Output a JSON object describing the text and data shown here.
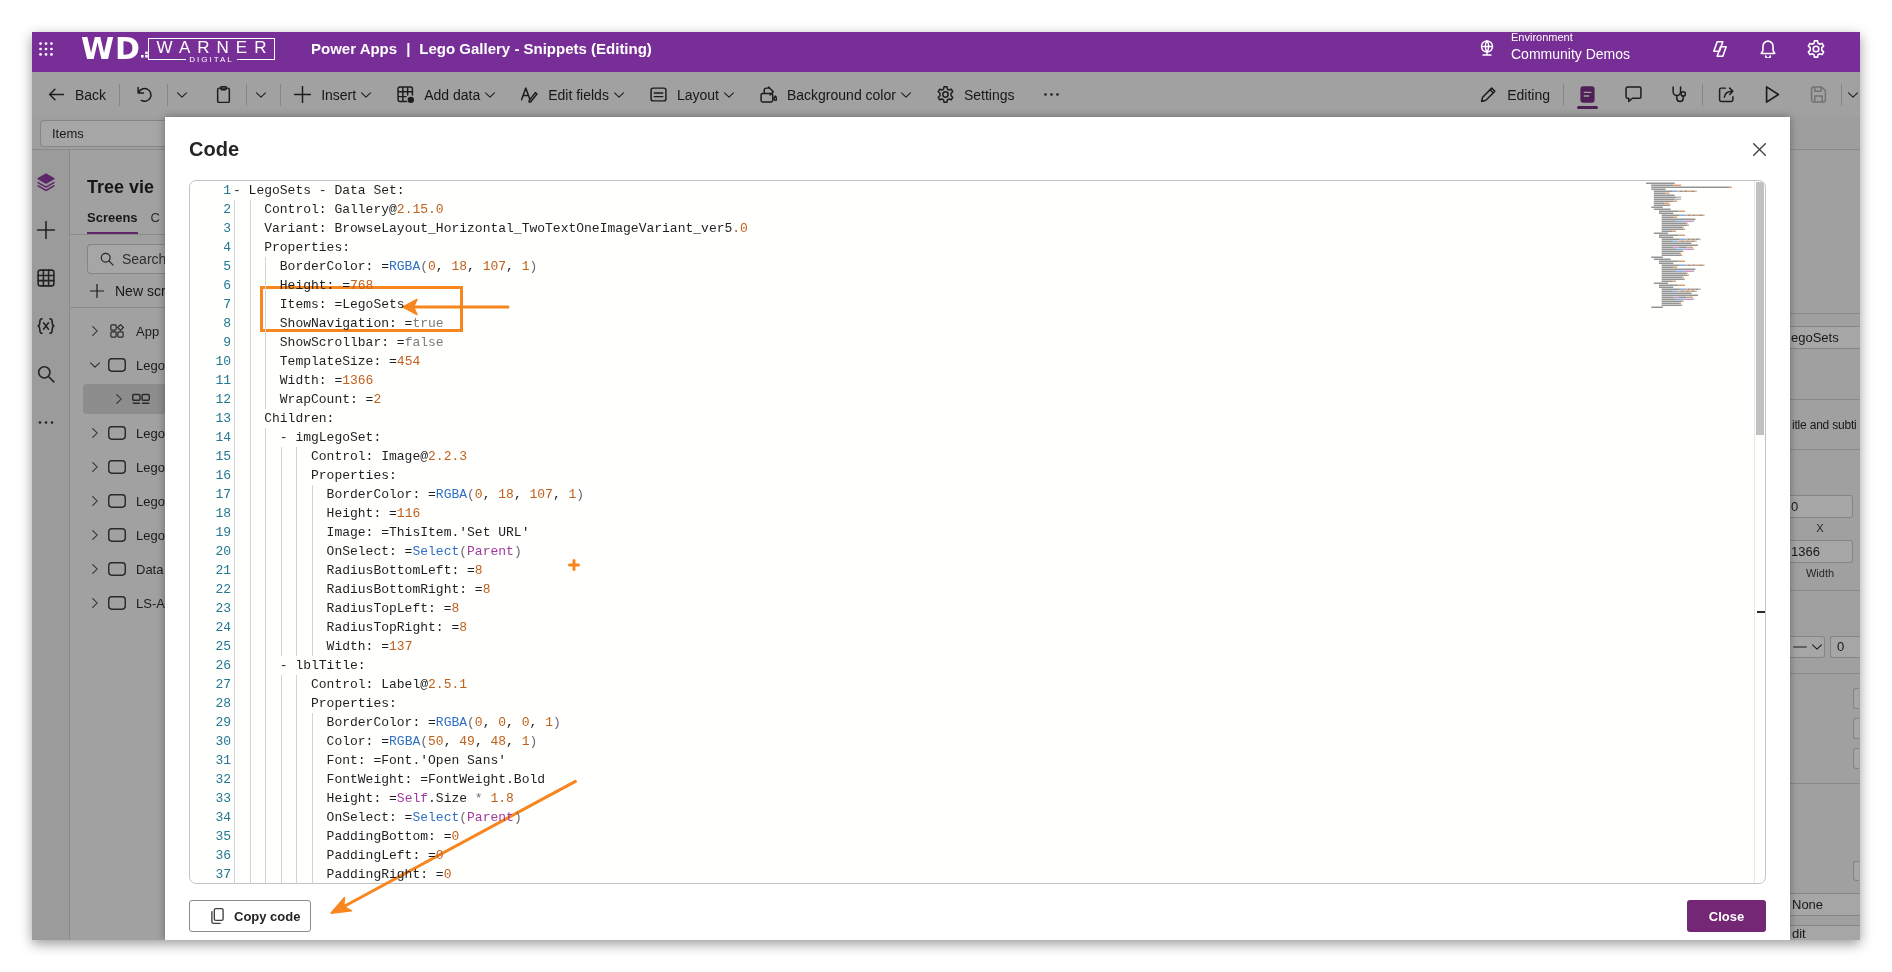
{
  "header": {
    "logo": {
      "mark": "WD",
      "wordmark": "WARNER",
      "tagline": "DIGITAL"
    },
    "app_name": "Power Apps",
    "separator": "|",
    "document_title": "Lego Gallery - Snippets (Editing)",
    "environment": {
      "label": "Environment",
      "name": "Community Demos"
    }
  },
  "toolbar": {
    "left": [
      {
        "label": "Back",
        "dropdown": false,
        "divider_after": true
      },
      {
        "dropdown": true,
        "divider_after": false
      },
      {
        "dropdown": true,
        "divider_after": true
      },
      {
        "label": "Insert",
        "dropdown": true,
        "divider_after": false
      },
      {
        "label": "Add data",
        "dropdown": true,
        "divider_after": false
      },
      {
        "label": "Edit fields",
        "dropdown": true,
        "divider_after": false
      },
      {
        "label": "Layout",
        "dropdown": true,
        "divider_after": false
      },
      {
        "label": "Background color",
        "dropdown": true,
        "divider_after": false
      },
      {
        "label": "Settings",
        "dropdown": false,
        "divider_after": false
      },
      {
        "dropdown": false,
        "divider_after": false
      }
    ],
    "right": [
      {
        "label": "Editing",
        "selected": false,
        "disabled": false,
        "divider_after": true
      },
      {
        "selected": true,
        "disabled": false,
        "divider_after": false
      },
      {
        "selected": false,
        "disabled": false,
        "divider_after": false
      },
      {
        "selected": false,
        "disabled": false,
        "divider_after": true
      },
      {
        "selected": false,
        "disabled": false,
        "divider_after": false
      },
      {
        "selected": false,
        "disabled": false,
        "divider_after": false
      },
      {
        "selected": false,
        "disabled": true,
        "divider_after": true
      },
      {
        "selected": false,
        "disabled": false,
        "divider_after": false
      }
    ]
  },
  "formula_bar": {
    "property": "Items"
  },
  "left_rail": [
    {
      "selected": true
    },
    {
      "selected": false
    },
    {
      "selected": false
    },
    {
      "selected": false
    },
    {
      "selected": false
    },
    {
      "selected": false
    }
  ],
  "tree_view": {
    "title": "Tree vie",
    "tabs": [
      {
        "label": "Screens",
        "selected": true
      },
      {
        "label": "C",
        "selected": false
      }
    ],
    "search": {
      "placeholder": "Search"
    },
    "new_screen": "New scr",
    "items": [
      {
        "label": "App",
        "kind": "app",
        "expanded": false,
        "selected": false
      },
      {
        "label": "Lego",
        "kind": "screen",
        "expanded": true,
        "selected": false,
        "children": [
          {
            "kind": "gallery",
            "expanded": false,
            "selected": true
          }
        ]
      },
      {
        "label": "Lego",
        "kind": "screen",
        "expanded": false,
        "selected": false
      },
      {
        "label": "Lego",
        "kind": "screen",
        "expanded": false,
        "selected": false
      },
      {
        "label": "Lego",
        "kind": "screen",
        "expanded": false,
        "selected": false
      },
      {
        "label": "Lego",
        "kind": "screen",
        "expanded": false,
        "selected": false
      },
      {
        "label": "Data",
        "kind": "screen",
        "expanded": false,
        "selected": false
      },
      {
        "label": "LS-A",
        "kind": "screen",
        "expanded": false,
        "selected": false
      }
    ]
  },
  "code_dialog": {
    "title": "Code",
    "lines": [
      {
        "number": "1",
        "tokens": [
          {
            "text": "- LegoSets - Data Set:",
            "kind": "plain"
          }
        ]
      },
      {
        "number": "2",
        "tokens": [
          {
            "text": "    Control: Gallery@",
            "kind": "plain"
          },
          {
            "text": "2.15.0",
            "kind": "number"
          }
        ]
      },
      {
        "number": "3",
        "tokens": [
          {
            "text": "    Variant: BrowseLayout_Horizontal_TwoTextOneImageVariant_ver5",
            "kind": "plain"
          },
          {
            "text": ".0",
            "kind": "number"
          }
        ]
      },
      {
        "number": "4",
        "tokens": [
          {
            "text": "    Properties:",
            "kind": "plain"
          }
        ]
      },
      {
        "number": "5",
        "tokens": [
          {
            "text": "      BorderColor: =",
            "kind": "plain"
          },
          {
            "text": "RGBA",
            "kind": "function"
          },
          {
            "text": "(",
            "kind": "punct"
          },
          {
            "text": "0",
            "kind": "number"
          },
          {
            "text": ", ",
            "kind": "plain"
          },
          {
            "text": "18",
            "kind": "number"
          },
          {
            "text": ", ",
            "kind": "plain"
          },
          {
            "text": "107",
            "kind": "number"
          },
          {
            "text": ", ",
            "kind": "plain"
          },
          {
            "text": "1",
            "kind": "number"
          },
          {
            "text": ")",
            "kind": "punct"
          }
        ]
      },
      {
        "number": "6",
        "tokens": [
          {
            "text": "      Height: =",
            "kind": "plain"
          },
          {
            "text": "768",
            "kind": "number"
          }
        ]
      },
      {
        "number": "7",
        "tokens": [
          {
            "text": "      Items: =LegoSets",
            "kind": "plain"
          }
        ]
      },
      {
        "number": "8",
        "tokens": [
          {
            "text": "      ShowNavigation: =",
            "kind": "plain"
          },
          {
            "text": "true",
            "kind": "literal"
          }
        ]
      },
      {
        "number": "9",
        "tokens": [
          {
            "text": "      ShowScrollbar: =",
            "kind": "plain"
          },
          {
            "text": "false",
            "kind": "literal"
          }
        ]
      },
      {
        "number": "10",
        "tokens": [
          {
            "text": "      TemplateSize: =",
            "kind": "plain"
          },
          {
            "text": "454",
            "kind": "number"
          }
        ]
      },
      {
        "number": "11",
        "tokens": [
          {
            "text": "      Width: =",
            "kind": "plain"
          },
          {
            "text": "1366",
            "kind": "number"
          }
        ]
      },
      {
        "number": "12",
        "tokens": [
          {
            "text": "      WrapCount: =",
            "kind": "plain"
          },
          {
            "text": "2",
            "kind": "number"
          }
        ]
      },
      {
        "number": "13",
        "tokens": [
          {
            "text": "    Children:",
            "kind": "plain"
          }
        ]
      },
      {
        "number": "14",
        "tokens": [
          {
            "text": "      - imgLegoSet:",
            "kind": "plain"
          }
        ]
      },
      {
        "number": "15",
        "tokens": [
          {
            "text": "          Control: Image@",
            "kind": "plain"
          },
          {
            "text": "2.2.3",
            "kind": "number"
          }
        ]
      },
      {
        "number": "16",
        "tokens": [
          {
            "text": "          Properties:",
            "kind": "plain"
          }
        ]
      },
      {
        "number": "17",
        "tokens": [
          {
            "text": "            BorderColor: =",
            "kind": "plain"
          },
          {
            "text": "RGBA",
            "kind": "function"
          },
          {
            "text": "(",
            "kind": "punct"
          },
          {
            "text": "0",
            "kind": "number"
          },
          {
            "text": ", ",
            "kind": "plain"
          },
          {
            "text": "18",
            "kind": "number"
          },
          {
            "text": ", ",
            "kind": "plain"
          },
          {
            "text": "107",
            "kind": "number"
          },
          {
            "text": ", ",
            "kind": "plain"
          },
          {
            "text": "1",
            "kind": "number"
          },
          {
            "text": ")",
            "kind": "punct"
          }
        ]
      },
      {
        "number": "18",
        "tokens": [
          {
            "text": "            Height: =",
            "kind": "plain"
          },
          {
            "text": "116",
            "kind": "number"
          }
        ]
      },
      {
        "number": "19",
        "tokens": [
          {
            "text": "            Image: =ThisItem.'Set URL'",
            "kind": "plain"
          }
        ]
      },
      {
        "number": "20",
        "tokens": [
          {
            "text": "            OnSelect: =",
            "kind": "plain"
          },
          {
            "text": "Select",
            "kind": "function"
          },
          {
            "text": "(",
            "kind": "punct"
          },
          {
            "text": "Parent",
            "kind": "keyword"
          },
          {
            "text": ")",
            "kind": "punct"
          }
        ]
      },
      {
        "number": "21",
        "tokens": [
          {
            "text": "            RadiusBottomLeft: =",
            "kind": "plain"
          },
          {
            "text": "8",
            "kind": "number"
          }
        ]
      },
      {
        "number": "22",
        "tokens": [
          {
            "text": "            RadiusBottomRight: =",
            "kind": "plain"
          },
          {
            "text": "8",
            "kind": "number"
          }
        ]
      },
      {
        "number": "23",
        "tokens": [
          {
            "text": "            RadiusTopLeft: =",
            "kind": "plain"
          },
          {
            "text": "8",
            "kind": "number"
          }
        ]
      },
      {
        "number": "24",
        "tokens": [
          {
            "text": "            RadiusTopRight: =",
            "kind": "plain"
          },
          {
            "text": "8",
            "kind": "number"
          }
        ]
      },
      {
        "number": "25",
        "tokens": [
          {
            "text": "            Width: =",
            "kind": "plain"
          },
          {
            "text": "137",
            "kind": "number"
          }
        ]
      },
      {
        "number": "26",
        "tokens": [
          {
            "text": "      - lblTitle:",
            "kind": "plain"
          }
        ]
      },
      {
        "number": "27",
        "tokens": [
          {
            "text": "          Control: Label@",
            "kind": "plain"
          },
          {
            "text": "2.5.1",
            "kind": "number"
          }
        ]
      },
      {
        "number": "28",
        "tokens": [
          {
            "text": "          Properties:",
            "kind": "plain"
          }
        ]
      },
      {
        "number": "29",
        "tokens": [
          {
            "text": "            BorderColor: =",
            "kind": "plain"
          },
          {
            "text": "RGBA",
            "kind": "function"
          },
          {
            "text": "(",
            "kind": "punct"
          },
          {
            "text": "0",
            "kind": "number"
          },
          {
            "text": ", ",
            "kind": "plain"
          },
          {
            "text": "0",
            "kind": "number"
          },
          {
            "text": ", ",
            "kind": "plain"
          },
          {
            "text": "0",
            "kind": "number"
          },
          {
            "text": ", ",
            "kind": "plain"
          },
          {
            "text": "1",
            "kind": "number"
          },
          {
            "text": ")",
            "kind": "punct"
          }
        ]
      },
      {
        "number": "30",
        "tokens": [
          {
            "text": "            Color: =",
            "kind": "plain"
          },
          {
            "text": "RGBA",
            "kind": "function"
          },
          {
            "text": "(",
            "kind": "punct"
          },
          {
            "text": "50",
            "kind": "number"
          },
          {
            "text": ", ",
            "kind": "plain"
          },
          {
            "text": "49",
            "kind": "number"
          },
          {
            "text": ", ",
            "kind": "plain"
          },
          {
            "text": "48",
            "kind": "number"
          },
          {
            "text": ", ",
            "kind": "plain"
          },
          {
            "text": "1",
            "kind": "number"
          },
          {
            "text": ")",
            "kind": "punct"
          }
        ]
      },
      {
        "number": "31",
        "tokens": [
          {
            "text": "            Font: =Font.'Open Sans'",
            "kind": "plain"
          }
        ]
      },
      {
        "number": "32",
        "tokens": [
          {
            "text": "            FontWeight: =FontWeight.Bold",
            "kind": "plain"
          }
        ]
      },
      {
        "number": "33",
        "tokens": [
          {
            "text": "            Height: =",
            "kind": "plain"
          },
          {
            "text": "Self",
            "kind": "keyword"
          },
          {
            "text": ".Size ",
            "kind": "plain"
          },
          {
            "text": "* ",
            "kind": "punct"
          },
          {
            "text": "1.8",
            "kind": "number"
          }
        ]
      },
      {
        "number": "34",
        "tokens": [
          {
            "text": "            OnSelect: =",
            "kind": "plain"
          },
          {
            "text": "Select",
            "kind": "function"
          },
          {
            "text": "(",
            "kind": "punct"
          },
          {
            "text": "Parent",
            "kind": "keyword"
          },
          {
            "text": ")",
            "kind": "punct"
          }
        ]
      },
      {
        "number": "35",
        "tokens": [
          {
            "text": "            PaddingBottom: =",
            "kind": "plain"
          },
          {
            "text": "0",
            "kind": "number"
          }
        ]
      },
      {
        "number": "36",
        "tokens": [
          {
            "text": "            PaddingLeft: =",
            "kind": "plain"
          },
          {
            "text": "0",
            "kind": "number"
          }
        ]
      },
      {
        "number": "37",
        "tokens": [
          {
            "text": "            PaddingRight: =",
            "kind": "plain"
          },
          {
            "text": "0",
            "kind": "number"
          }
        ]
      }
    ],
    "buttons": [
      {
        "label": "Copy code",
        "kind": "outline"
      },
      {
        "label": "Close",
        "kind": "primary"
      }
    ]
  },
  "properties_panel": {
    "field_1": "egoSets",
    "text_1": "itle and subti",
    "x_field": "0",
    "x_label": "X",
    "width_field": "1366",
    "width_label": "Width",
    "field_2": "0",
    "field_3": "None",
    "field_4": "dit"
  }
}
